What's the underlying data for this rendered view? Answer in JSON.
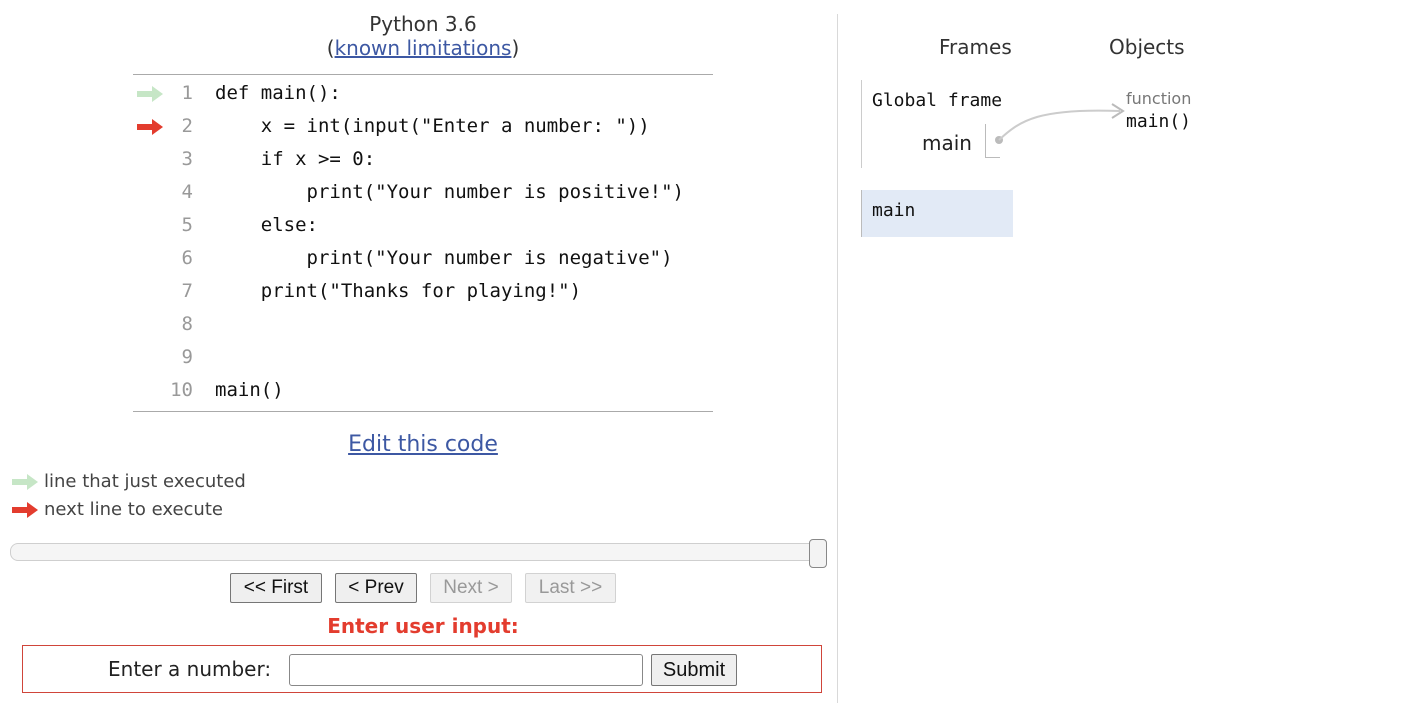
{
  "header": {
    "language": "Python 3.6",
    "limitations_link": "known limitations"
  },
  "code": {
    "lines": [
      {
        "num": "1",
        "text": "def main():",
        "arrow": "green"
      },
      {
        "num": "2",
        "text": "    x = int(input(\"Enter a number: \"))",
        "arrow": "red"
      },
      {
        "num": "3",
        "text": "    if x >= 0:",
        "arrow": ""
      },
      {
        "num": "4",
        "text": "        print(\"Your number is positive!\")",
        "arrow": ""
      },
      {
        "num": "5",
        "text": "    else:",
        "arrow": ""
      },
      {
        "num": "6",
        "text": "        print(\"Your number is negative\")",
        "arrow": ""
      },
      {
        "num": "7",
        "text": "    print(\"Thanks for playing!\")",
        "arrow": ""
      },
      {
        "num": "8",
        "text": "",
        "arrow": ""
      },
      {
        "num": "9",
        "text": "",
        "arrow": ""
      },
      {
        "num": "10",
        "text": "main()",
        "arrow": ""
      }
    ]
  },
  "edit_link": "Edit this code",
  "legend": {
    "just_executed": "line that just executed",
    "next_line": "next line to execute"
  },
  "navigation": {
    "step_position": 1.0,
    "first": "<< First",
    "prev": "< Prev",
    "next": "Next >",
    "last": "Last >>"
  },
  "user_input": {
    "title": "Enter user input:",
    "prompt": "Enter a number:",
    "value": "",
    "submit": "Submit"
  },
  "visualization": {
    "frames_header": "Frames",
    "objects_header": "Objects",
    "global_frame": {
      "title": "Global frame",
      "variables": [
        {
          "name": "main"
        }
      ]
    },
    "stack_frames": [
      {
        "title": "main"
      }
    ],
    "objects": [
      {
        "type": "function",
        "name": "main()"
      }
    ]
  },
  "colors": {
    "arrow_green": "#c6e6c6",
    "arrow_red": "#e33c2e",
    "link": "#3d58a3",
    "frame_highlight": "#e2eaf6"
  }
}
